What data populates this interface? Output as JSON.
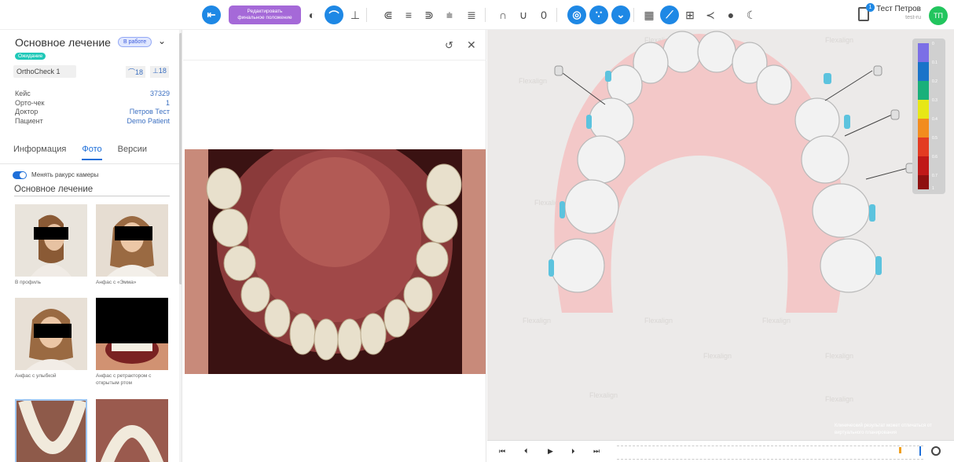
{
  "toolbar": {
    "edit_final_line1": "Редактировать",
    "edit_final_line2": "финальное положение",
    "accent": "#1e88e5",
    "purple": "#a569d8"
  },
  "user": {
    "name": "Тест Петров",
    "sub": "test-ru",
    "initials": "ТП",
    "notifications": "1"
  },
  "treatment": {
    "title": "Основное лечение",
    "status": "В работе",
    "waiting": "Ожидание",
    "orthocheck": "OrthoCheck 1",
    "upper_count": "18",
    "lower_count": "18"
  },
  "info": [
    {
      "k": "Кейс",
      "v": "37329"
    },
    {
      "k": "Орто-чек",
      "v": "1"
    },
    {
      "k": "Доктор",
      "v": "Петров Тест"
    },
    {
      "k": "Пациент",
      "v": "Demo Patient"
    }
  ],
  "tabs": [
    "Информация",
    "Фото",
    "Версии"
  ],
  "active_tab": "Фото",
  "camera_toggle": "Менять ракурс камеры",
  "section_title": "Основное лечение",
  "photos": [
    {
      "caption": "В профиль"
    },
    {
      "caption": "Анфас с «Эмма»"
    },
    {
      "caption": "Анфас с улыбкой"
    },
    {
      "caption": "Анфас с ретрактором с открытым ртом"
    },
    {
      "caption": ""
    },
    {
      "caption": ""
    }
  ],
  "viewer": {
    "watermark": "Flexalign",
    "disclaimer": "Клинический результат может отличаться от виртуального планирования",
    "scale_labels": [
      "0",
      "0.1",
      "0.2",
      "0.3",
      "0.4",
      "0.5",
      "0.6",
      "0.7",
      "1"
    ]
  }
}
